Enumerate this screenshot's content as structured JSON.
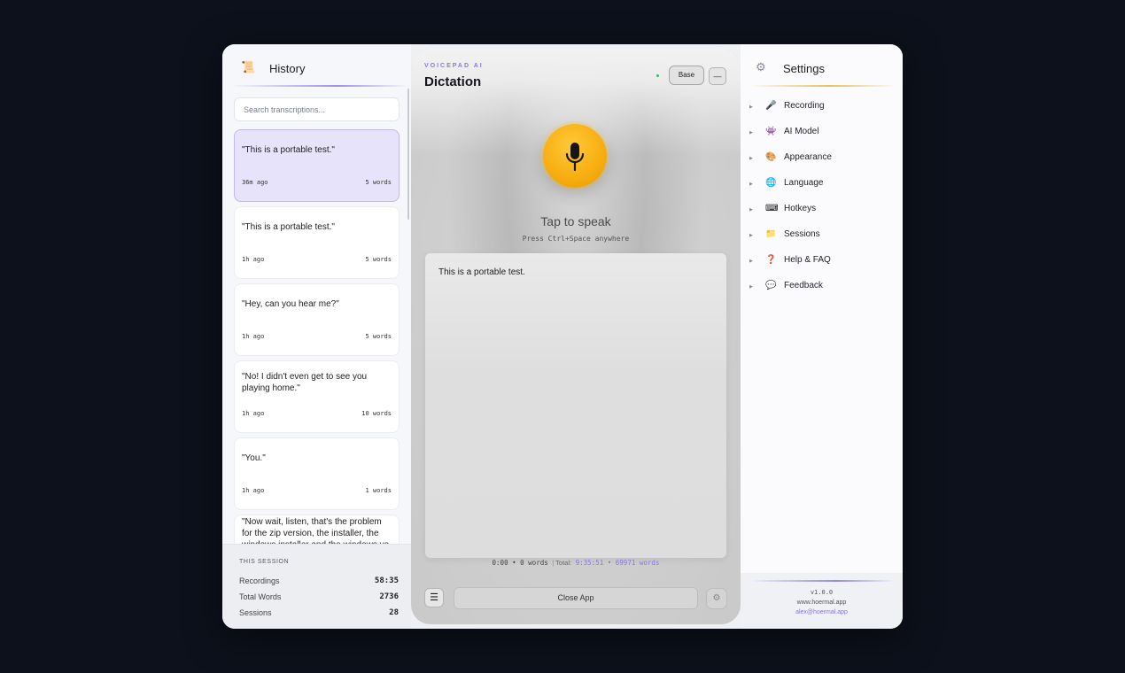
{
  "history": {
    "icon": "scroll-icon",
    "title": "History",
    "search_placeholder": "Search transcriptions...",
    "items": [
      {
        "text": "\"This is a portable test.\"",
        "time": "36m ago",
        "words": "5 words",
        "active": true
      },
      {
        "text": "\"This is a portable test.\"",
        "time": "1h ago",
        "words": "5 words",
        "active": false
      },
      {
        "text": "\"Hey, can you hear me?\"",
        "time": "1h ago",
        "words": "5 words",
        "active": false
      },
      {
        "text": "\"No! I didn't even get to see you playing home.\"",
        "time": "1h ago",
        "words": "10 words",
        "active": false
      },
      {
        "text": "\"You.\"",
        "time": "1h ago",
        "words": "1 words",
        "active": false
      },
      {
        "text": "\"Now wait, listen, that's the problem for the zip version, the installer, the windows installer and the windows ve",
        "time": "",
        "words": "",
        "active": false
      }
    ],
    "session": {
      "title": "THIS SESSION",
      "rows": [
        {
          "label": "Recordings",
          "value": "58:35"
        },
        {
          "label": "Total Words",
          "value": "2736"
        },
        {
          "label": "Sessions",
          "value": "28"
        }
      ]
    }
  },
  "dictation": {
    "brand": "VOICEPAD AI",
    "title": "Dictation",
    "model_button": "Base",
    "minimize_button": "—",
    "prompt": "Tap to speak",
    "hint": "Press Ctrl+Space anywhere",
    "transcript": "This is a portable test.",
    "stats": {
      "current": "0:00 • 0 words",
      "total_label": "Total:",
      "total_time": "9:35:51",
      "total_words": "• 69971 words"
    },
    "menu_button": "☰",
    "close_button": "Close App",
    "accent": "#f7ad0f"
  },
  "settings": {
    "title": "Settings",
    "icon": "gear-icon",
    "items": [
      {
        "label": "Recording",
        "icon": "microphone-icon",
        "glyph": "🎤"
      },
      {
        "label": "AI Model",
        "icon": "robot-icon",
        "glyph": "👾"
      },
      {
        "label": "Appearance",
        "icon": "palette-icon",
        "glyph": "🎨"
      },
      {
        "label": "Language",
        "icon": "globe-icon",
        "glyph": "🌐"
      },
      {
        "label": "Hotkeys",
        "icon": "keyboard-icon",
        "glyph": "⌨"
      },
      {
        "label": "Sessions",
        "icon": "folder-icon",
        "glyph": "📁"
      },
      {
        "label": "Help & FAQ",
        "icon": "question-icon",
        "glyph": "❓"
      },
      {
        "label": "Feedback",
        "icon": "speech-bubble-icon",
        "glyph": "💬"
      }
    ],
    "footer": {
      "version": "v1.0.0",
      "website": "www.hoermal.app",
      "email": "alex@hoermal.app"
    }
  }
}
